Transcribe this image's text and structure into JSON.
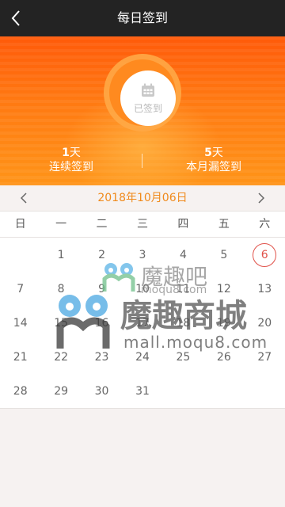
{
  "header": {
    "title": "每日签到",
    "back_icon": "chevron-left-icon"
  },
  "sign": {
    "label": "已签到",
    "icon": "calendar-icon",
    "signed": true
  },
  "stats": {
    "consecutive": {
      "value": "1",
      "unit": "天",
      "label": "连续签到"
    },
    "missed": {
      "value": "5",
      "unit": "天",
      "label": "本月漏签到"
    }
  },
  "calendar": {
    "month_label": "2018年10月06日",
    "prev_icon": "chevron-left-icon",
    "next_icon": "chevron-right-icon",
    "weekdays": [
      "日",
      "一",
      "二",
      "三",
      "四",
      "五",
      "六"
    ],
    "today": "6",
    "weeks": [
      [
        "",
        "1",
        "2",
        "3",
        "4",
        "5",
        "6"
      ],
      [
        "7",
        "8",
        "9",
        "10",
        "11",
        "12",
        "13"
      ],
      [
        "14",
        "15",
        "16",
        "17",
        "18",
        "19",
        "20"
      ],
      [
        "21",
        "22",
        "23",
        "24",
        "25",
        "26",
        "27"
      ],
      [
        "28",
        "29",
        "30",
        "31",
        "",
        "",
        ""
      ]
    ]
  },
  "watermark": {
    "small_text": "魔趣吧",
    "small_url": "moqu8.com",
    "big_text": "魔趣商城",
    "big_url": "mall.moqu8.com"
  },
  "colors": {
    "topbar": "#232323",
    "accent": "#f08a1c",
    "today_ring": "#e0524a",
    "hero": "#ff7a12"
  }
}
